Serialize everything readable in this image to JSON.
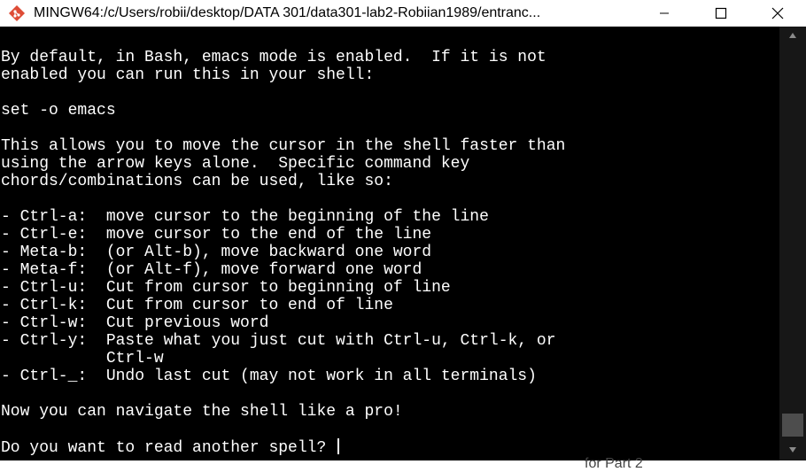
{
  "window": {
    "title": "MINGW64:/c/Users/robii/desktop/DATA 301/data301-lab2-Robiian1989/entranc..."
  },
  "icons": {
    "app": "git-bash-diamond-icon",
    "minimize": "minimize-icon",
    "maximize": "maximize-icon",
    "close": "close-icon"
  },
  "colors": {
    "terminal_bg": "#000000",
    "terminal_fg": "#ffffff",
    "app_icon": "#de4c36"
  },
  "terminal": {
    "lines": [
      "By default, in Bash, emacs mode is enabled.  If it is not",
      "enabled you can run this in your shell:",
      "",
      "set -o emacs",
      "",
      "This allows you to move the cursor in the shell faster than",
      "using the arrow keys alone.  Specific command key",
      "chords/combinations can be used, like so:",
      "",
      "- Ctrl-a:  move cursor to the beginning of the line",
      "- Ctrl-e:  move cursor to the end of the line",
      "- Meta-b:  (or Alt-b), move backward one word",
      "- Meta-f:  (or Alt-f), move forward one word",
      "- Ctrl-u:  Cut from cursor to beginning of line",
      "- Ctrl-k:  Cut from cursor to end of line",
      "- Ctrl-w:  Cut previous word",
      "- Ctrl-y:  Paste what you just cut with Ctrl-u, Ctrl-k, or",
      "           Ctrl-w",
      "- Ctrl-_:  Undo last cut (may not work in all terminals)",
      "",
      "Now you can navigate the shell like a pro!",
      ""
    ],
    "prompt": "Do you want to read another spell? "
  },
  "background_window": {
    "peek_text": "for Part 2"
  }
}
